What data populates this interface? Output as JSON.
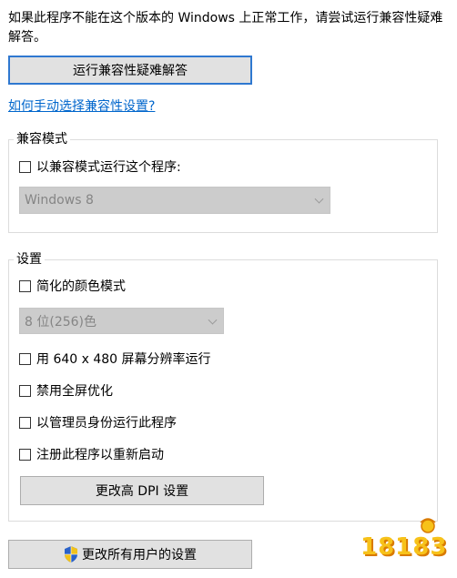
{
  "intro": {
    "text": "如果此程序不能在这个版本的 Windows 上正常工作，请尝试运行兼容性疑难解答。"
  },
  "troubleshooter_button": "运行兼容性疑难解答",
  "manual_link": "如何手动选择兼容性设置?",
  "compat_mode": {
    "legend": "兼容模式",
    "checkbox_label": "以兼容模式运行这个程序:",
    "checked": false,
    "os_select": "Windows 8"
  },
  "settings": {
    "legend": "设置",
    "reduced_color": {
      "label": "简化的颜色模式",
      "checked": false
    },
    "color_select": "8 位(256)色",
    "run_640": {
      "label": "用 640 x 480 屏幕分辨率运行",
      "checked": false
    },
    "disable_fullscreen": {
      "label": "禁用全屏优化",
      "checked": false
    },
    "run_admin": {
      "label": "以管理员身份运行此程序",
      "checked": false
    },
    "register_restart": {
      "label": "注册此程序以重新启动",
      "checked": false
    },
    "dpi_button": "更改高 DPI 设置"
  },
  "all_users_button": "更改所有用户的设置",
  "watermark": "18183",
  "colors": {
    "link": "#0066cc",
    "button_bg": "#e1e1e1",
    "focus_border": "#2f78d0",
    "disabled_select_bg": "#cccccc"
  },
  "icons": {
    "all_users_button": "uac-shield-icon"
  }
}
